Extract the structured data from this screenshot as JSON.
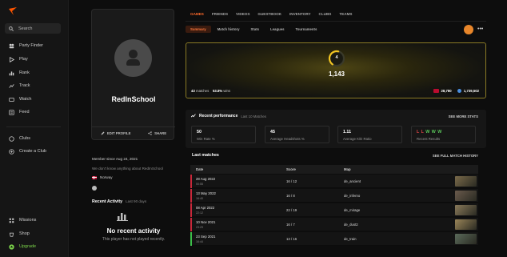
{
  "sidebar": {
    "search": "Search",
    "items": [
      {
        "label": "Party Finder",
        "icon": "party-finder-icon"
      },
      {
        "label": "Play",
        "icon": "play-icon"
      },
      {
        "label": "Rank",
        "icon": "rank-icon"
      },
      {
        "label": "Track",
        "icon": "track-icon"
      },
      {
        "label": "Watch",
        "icon": "watch-icon"
      },
      {
        "label": "Feed",
        "icon": "feed-icon"
      }
    ],
    "clubs": "Clubs",
    "create_club": "Create a Club",
    "missions": "Missions",
    "shop": "Shop",
    "upgrade": "Upgrade"
  },
  "profile": {
    "username": "RedInSchool",
    "edit_profile": "EDIT PROFILE",
    "share": "SHARE",
    "member_since": "Member since Aug 24, 2021",
    "bio": "We don't know anything about RedInSchool",
    "country": "Norway"
  },
  "activity": {
    "title": "Recent Activity",
    "range": "Last 90 days",
    "empty_title": "No recent activity",
    "empty_sub": "This player has not played recently."
  },
  "tabs": [
    "GAMES",
    "FRIENDS",
    "VIDEOS",
    "GUESTBOOK",
    "INVENTORY",
    "CLUBS",
    "TEAMS"
  ],
  "subtabs": [
    "Summary",
    "Match history",
    "Stats",
    "Leagues",
    "Tournaments"
  ],
  "hero": {
    "level": "4",
    "elo": "1,143",
    "matches": "43",
    "matches_label": "matches",
    "winrate": "53.8%",
    "winrate_label": "wins",
    "country_rank": "28,780",
    "world_rank": "1,739,502",
    "level_progress": 0.55
  },
  "performance": {
    "title": "Recent performance",
    "range": "Last 10 Matches",
    "see_more": "SEE MORE STATS",
    "stats": [
      {
        "value": "50",
        "label": "Win Rate %"
      },
      {
        "value": "45",
        "label": "Average Headshots %"
      },
      {
        "value": "1.11",
        "label": "Average K/D Ratio"
      },
      {
        "value": "L L W W W",
        "label": "Recent Results"
      }
    ]
  },
  "matches": {
    "title": "Last matches",
    "see_full": "SEE FULL MATCH HISTORY",
    "headers": {
      "date": "Date",
      "score": "Score",
      "map": "Map"
    },
    "rows": [
      {
        "date": "28 Aug 2022",
        "time": "00:55",
        "score": "16 / 12",
        "map": "de_ancient",
        "result": "loss"
      },
      {
        "date": "13 May 2022",
        "time": "16:40",
        "score": "16 / 8",
        "map": "de_inferno",
        "result": "loss"
      },
      {
        "date": "08 Apr 2022",
        "time": "22:12",
        "score": "22 / 19",
        "map": "de_mirage",
        "result": "loss"
      },
      {
        "date": "10 Nov 2021",
        "time": "23:29",
        "score": "16 / 7",
        "map": "de_dust2",
        "result": "loss"
      },
      {
        "date": "23 Sep 2021",
        "time": "16:44",
        "score": "13 / 16",
        "map": "de_train",
        "result": "win"
      }
    ]
  },
  "colors": {
    "accent": "#ff5500",
    "loss": "#c8283a",
    "win": "#3cbf4a",
    "upgrade": "#7bd34a"
  }
}
